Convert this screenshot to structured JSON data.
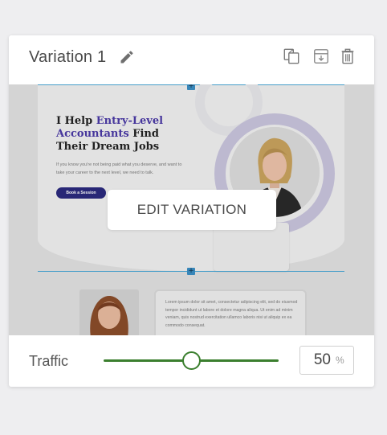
{
  "variation": {
    "title": "Variation 1",
    "icons": {
      "edit": "pencil-icon",
      "duplicate": "copy-icon",
      "save": "archive-icon",
      "delete": "trash-icon"
    }
  },
  "preview": {
    "hero": {
      "heading_part1": "I Help ",
      "heading_highlight": "Entry-Level Accountants",
      "heading_part2": " Find Their Dream Jobs",
      "text": "If you know you're not being paid what you deserve, and want to take your career to the next level, we need to talk.",
      "cta": "Book a Session"
    },
    "testimonial": {
      "text": "Lorem ipsum dolor sit amet, consectetur adipiscing elit, sed do eiusmod tempor incididunt ut labore et dolore magna aliqua. Ut enim ad minim veniam, quis nostrud exercitation ullamco laboris nisi ut aliquip ex ea commodo consequat."
    },
    "edit_button": "EDIT VARIATION"
  },
  "traffic": {
    "label": "Traffic",
    "value": "50",
    "unit": "%",
    "slider_fraction": 0.5
  },
  "colors": {
    "slider": "#3b7f2e",
    "highlight": "#4b3aa6",
    "cta": "#2b2a7e"
  }
}
